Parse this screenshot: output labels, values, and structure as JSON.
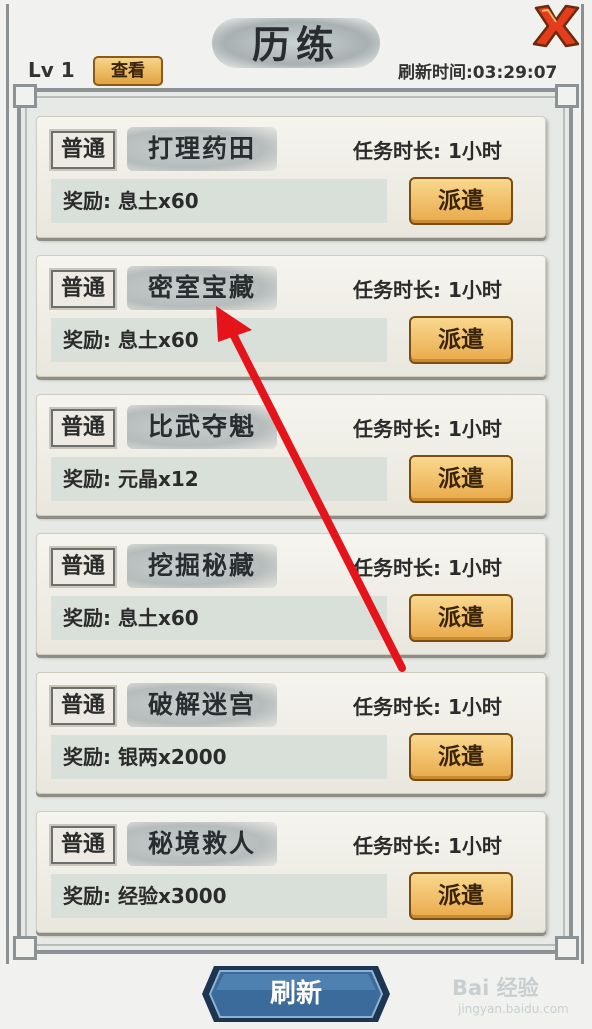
{
  "header": {
    "title": "历练",
    "level": "Lv 1",
    "view_button": "查看",
    "refresh_timer": "刷新时间:03:29:07",
    "close_icon": "close-x-icon"
  },
  "tasks": [
    {
      "badge": "普通",
      "name": "打理药田",
      "duration": "任务时长: 1小时",
      "reward": "奖励: 息土x60",
      "button": "派遣"
    },
    {
      "badge": "普通",
      "name": "密室宝藏",
      "duration": "任务时长: 1小时",
      "reward": "奖励: 息土x60",
      "button": "派遣"
    },
    {
      "badge": "普通",
      "name": "比武夺魁",
      "duration": "任务时长: 1小时",
      "reward": "奖励: 元晶x12",
      "button": "派遣"
    },
    {
      "badge": "普通",
      "name": "挖掘秘藏",
      "duration": "任务时长: 1小时",
      "reward": "奖励: 息土x60",
      "button": "派遣"
    },
    {
      "badge": "普通",
      "name": "破解迷宫",
      "duration": "任务时长: 1小时",
      "reward": "奖励: 银两x2000",
      "button": "派遣"
    },
    {
      "badge": "普通",
      "name": "秘境救人",
      "duration": "任务时长: 1小时",
      "reward": "奖励: 经验x3000",
      "button": "派遣"
    }
  ],
  "footer": {
    "refresh_button": "刷新",
    "watermark": "Bai 经验",
    "watermark_sub": "jingyan.baidu.com"
  },
  "colors": {
    "dispatch_button": "#e9a94a",
    "refresh_button": "#2f5a86",
    "annotation_arrow": "#e5141b",
    "close_icon": "#e53c1c"
  }
}
